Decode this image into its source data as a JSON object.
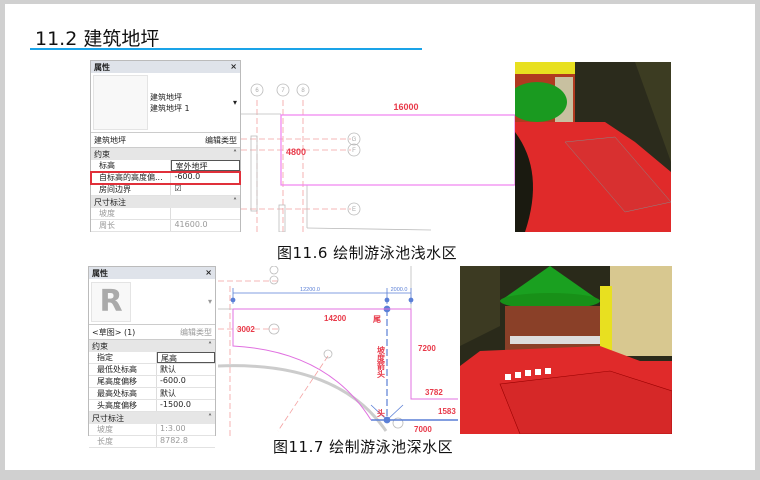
{
  "slide": {
    "title": "11.2 建筑地坪",
    "accent": "#1aa3e8"
  },
  "figure1": {
    "caption": "图11.6 绘制游泳池浅水区",
    "properties": {
      "header": "属性",
      "close": "×",
      "type_name": "建筑地坪",
      "type_sub": "建筑地坪 1",
      "selector": "建筑地坪",
      "edit_type": "编辑类型",
      "sections": [
        {
          "name": "约束",
          "rows": [
            {
              "key": "标高",
              "value": "室外地坪"
            },
            {
              "key": "自标高的高度偏...",
              "value": "-600.0",
              "highlighted": true
            },
            {
              "key": "房间边界",
              "value": "☑"
            }
          ]
        },
        {
          "name": "尺寸标注",
          "rows": [
            {
              "key": "坡度",
              "value": ""
            },
            {
              "key": "周长",
              "value": "41600.0"
            }
          ]
        }
      ]
    },
    "drawing": {
      "dim_width": "16000",
      "dim_height": "4800",
      "grid_labels": [
        "6",
        "7",
        "8",
        "G",
        "F",
        "E"
      ]
    }
  },
  "figure2": {
    "caption": "图11.7 绘制游泳池深水区",
    "properties": {
      "header": "属性",
      "close": "×",
      "logo": "R",
      "selector": "<草图> (1)",
      "edit_type": "编辑类型",
      "sections": [
        {
          "name": "约束",
          "rows": [
            {
              "key": "指定",
              "value": "尾高"
            },
            {
              "key": "最低处标高",
              "value": "默认"
            },
            {
              "key": "尾高度偏移",
              "value": "-600.0"
            },
            {
              "key": "最高处标高",
              "value": "默认"
            },
            {
              "key": "头高度偏移",
              "value": "-1500.0"
            }
          ]
        },
        {
          "name": "尺寸标注",
          "rows": [
            {
              "key": "坡度",
              "value": "1:3.00"
            },
            {
              "key": "长度",
              "value": "8782.8"
            }
          ]
        }
      ]
    },
    "drawing": {
      "dim_a": "12200.0",
      "dim_b": "2000.0",
      "d14200": "14200",
      "d3002": "3002",
      "d7200": "7200",
      "d3782": "3782",
      "d1583": "1583",
      "d7000": "7000",
      "tail": "尾",
      "head": "头",
      "arrow_label": "坡度箭头",
      "grid_labels": [
        "G",
        "F",
        "E"
      ]
    }
  }
}
